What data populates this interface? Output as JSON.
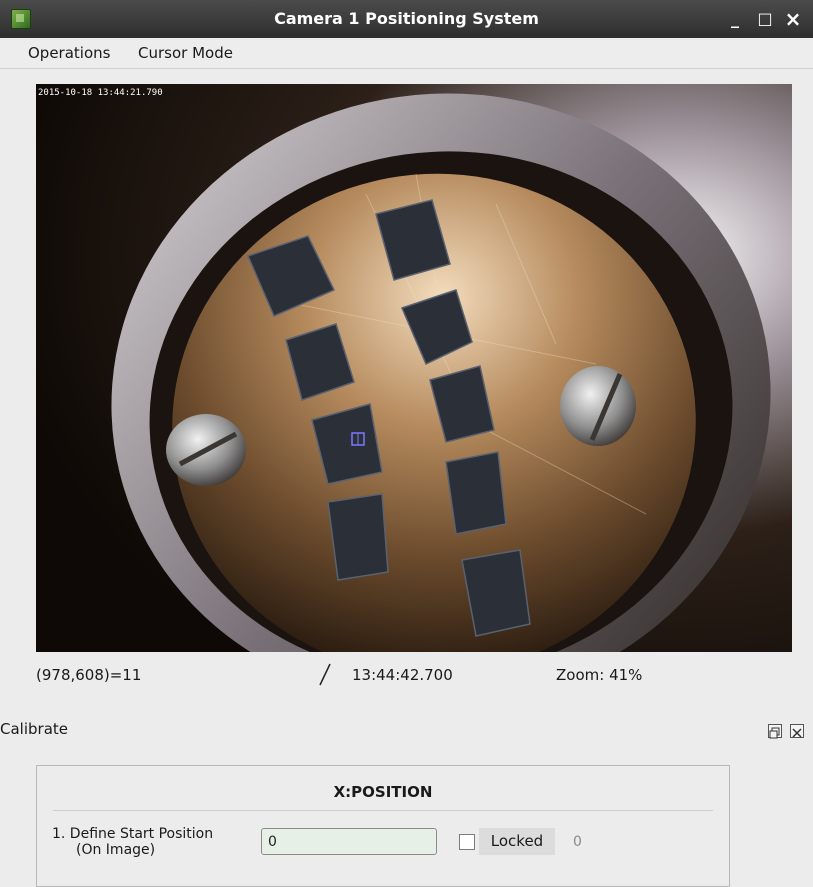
{
  "window": {
    "title": "Camera 1 Positioning System",
    "minimize": "_",
    "maximize": "□",
    "close": "×"
  },
  "menu": [
    "Operations",
    "Cursor Mode"
  ],
  "viewer": {
    "timestamp_overlay": "2015-10-18 13:44:21.790"
  },
  "status": {
    "cursor": "(978,608)=11",
    "time": "13:44:42.700",
    "zoom": "Zoom: 41%"
  },
  "calibrate": {
    "title": "Calibrate",
    "section_title": "X:POSITION",
    "step1_label_line1": "1. Define Start Position",
    "step1_label_line2": "(On Image)",
    "step1_value": "0",
    "locked_label": "Locked",
    "locked_value": "0"
  }
}
